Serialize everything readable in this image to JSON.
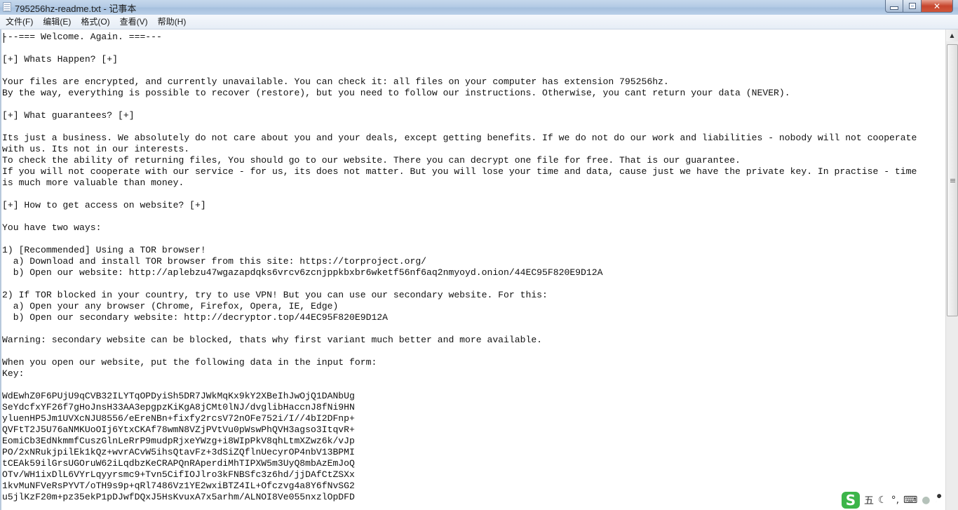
{
  "window": {
    "title": "795256hz-readme.txt - 记事本",
    "icon": "notepad-icon",
    "buttons": {
      "minimize": "minimize-icon",
      "maximize": "restore-icon",
      "close": "✕"
    }
  },
  "menu": [
    {
      "label": "文件(F)"
    },
    {
      "label": "编辑(E)"
    },
    {
      "label": "格式(O)"
    },
    {
      "label": "查看(V)"
    },
    {
      "label": "帮助(H)"
    }
  ],
  "document": {
    "lines": [
      "---=== Welcome. Again. ===---",
      "",
      "[+] Whats Happen? [+]",
      "",
      "Your files are encrypted, and currently unavailable. You can check it: all files on your computer has extension 795256hz.",
      "By the way, everything is possible to recover (restore), but you need to follow our instructions. Otherwise, you cant return your data (NEVER).",
      "",
      "[+] What guarantees? [+]",
      "",
      "Its just a business. We absolutely do not care about you and your deals, except getting benefits. If we do not do our work and liabilities - nobody will not cooperate",
      "with us. Its not in our interests.",
      "To check the ability of returning files, You should go to our website. There you can decrypt one file for free. That is our guarantee.",
      "If you will not cooperate with our service - for us, its does not matter. But you will lose your time and data, cause just we have the private key. In practise - time",
      "is much more valuable than money.",
      "",
      "[+] How to get access on website? [+]",
      "",
      "You have two ways:",
      "",
      "1) [Recommended] Using a TOR browser!",
      "  a) Download and install TOR browser from this site: https://torproject.org/",
      "  b) Open our website: http://aplebzu47wgazapdqks6vrcv6zcnjppkbxbr6wketf56nf6aq2nmyoyd.onion/44EC95F820E9D12A",
      "",
      "2) If TOR blocked in your country, try to use VPN! But you can use our secondary website. For this:",
      "  a) Open your any browser (Chrome, Firefox, Opera, IE, Edge)",
      "  b) Open our secondary website: http://decryptor.top/44EC95F820E9D12A",
      "",
      "Warning: secondary website can be blocked, thats why first variant much better and more available.",
      "",
      "When you open our website, put the following data in the input form:",
      "Key:",
      "",
      "WdEwhZ0F6PUjU9qCVB32ILYTqOPDyiSh5DR7JWkMqKx9kY2XBeIhJwOjQ1DANbUg",
      "SeYdcfxYF26f7gHoJnsH33AA3epgpzKiKgA8jCMt0lNJ/dvglibHaccnJ8fNi9HN",
      "yluenHP5Jm1UVXcNJU8556/eEreNBn+fixfy2rcsV72nOFe752i/I//4bI2DFnp+",
      "QVFtT2J5U76aNMKUoOIj6YtxCKAf78wmN8VZjPVtVu0pWswPhQVH3agso3ItqvR+",
      "EomiCb3EdNkmmfCuszGlnLeRrP9mudpRjxeYWzg+i8WIpPkV8qhLtmXZwz6k/vJp",
      "PO/2xNRukjpilEk1kQz+wvrACvW5ihsQtavFz+3dSiZQflnUecyrOP4nbV13BPMI",
      "tCEAk59ilGrsUGOruW62iLqdbzKeCRAPQnRAperdiMhTIPXW5m3UyQ8mbAzEmJoQ",
      "OTv/WH1ixDlL6VYrLqyyrsmc9+Tvn5CifIOJlro3kFNBSfc3z6hd/jjDAfCtZSXx",
      "1kvMuNFVeRsPYVT/oTH9s9p+qRl7486Vz1YE2wxiBTZ4IL+Ofczvg4a8Y6fNvSG2",
      "u5jlKzF20m+pz35ekP1pDJwfDQxJ5HsKvuxA7x5arhm/ALNOI8Ve055nxzlOpDFD"
    ]
  },
  "ime_toolbar": {
    "logo": "S",
    "mode": "五",
    "items": [
      "moon-icon",
      "punctuation-icon",
      "keyboard-icon",
      "user-icon",
      "wrench-icon"
    ],
    "glyphs": {
      "moon": "☾",
      "punct": "°,",
      "keyboard": "⌨",
      "user": "●",
      "wrench": "🔧"
    }
  }
}
